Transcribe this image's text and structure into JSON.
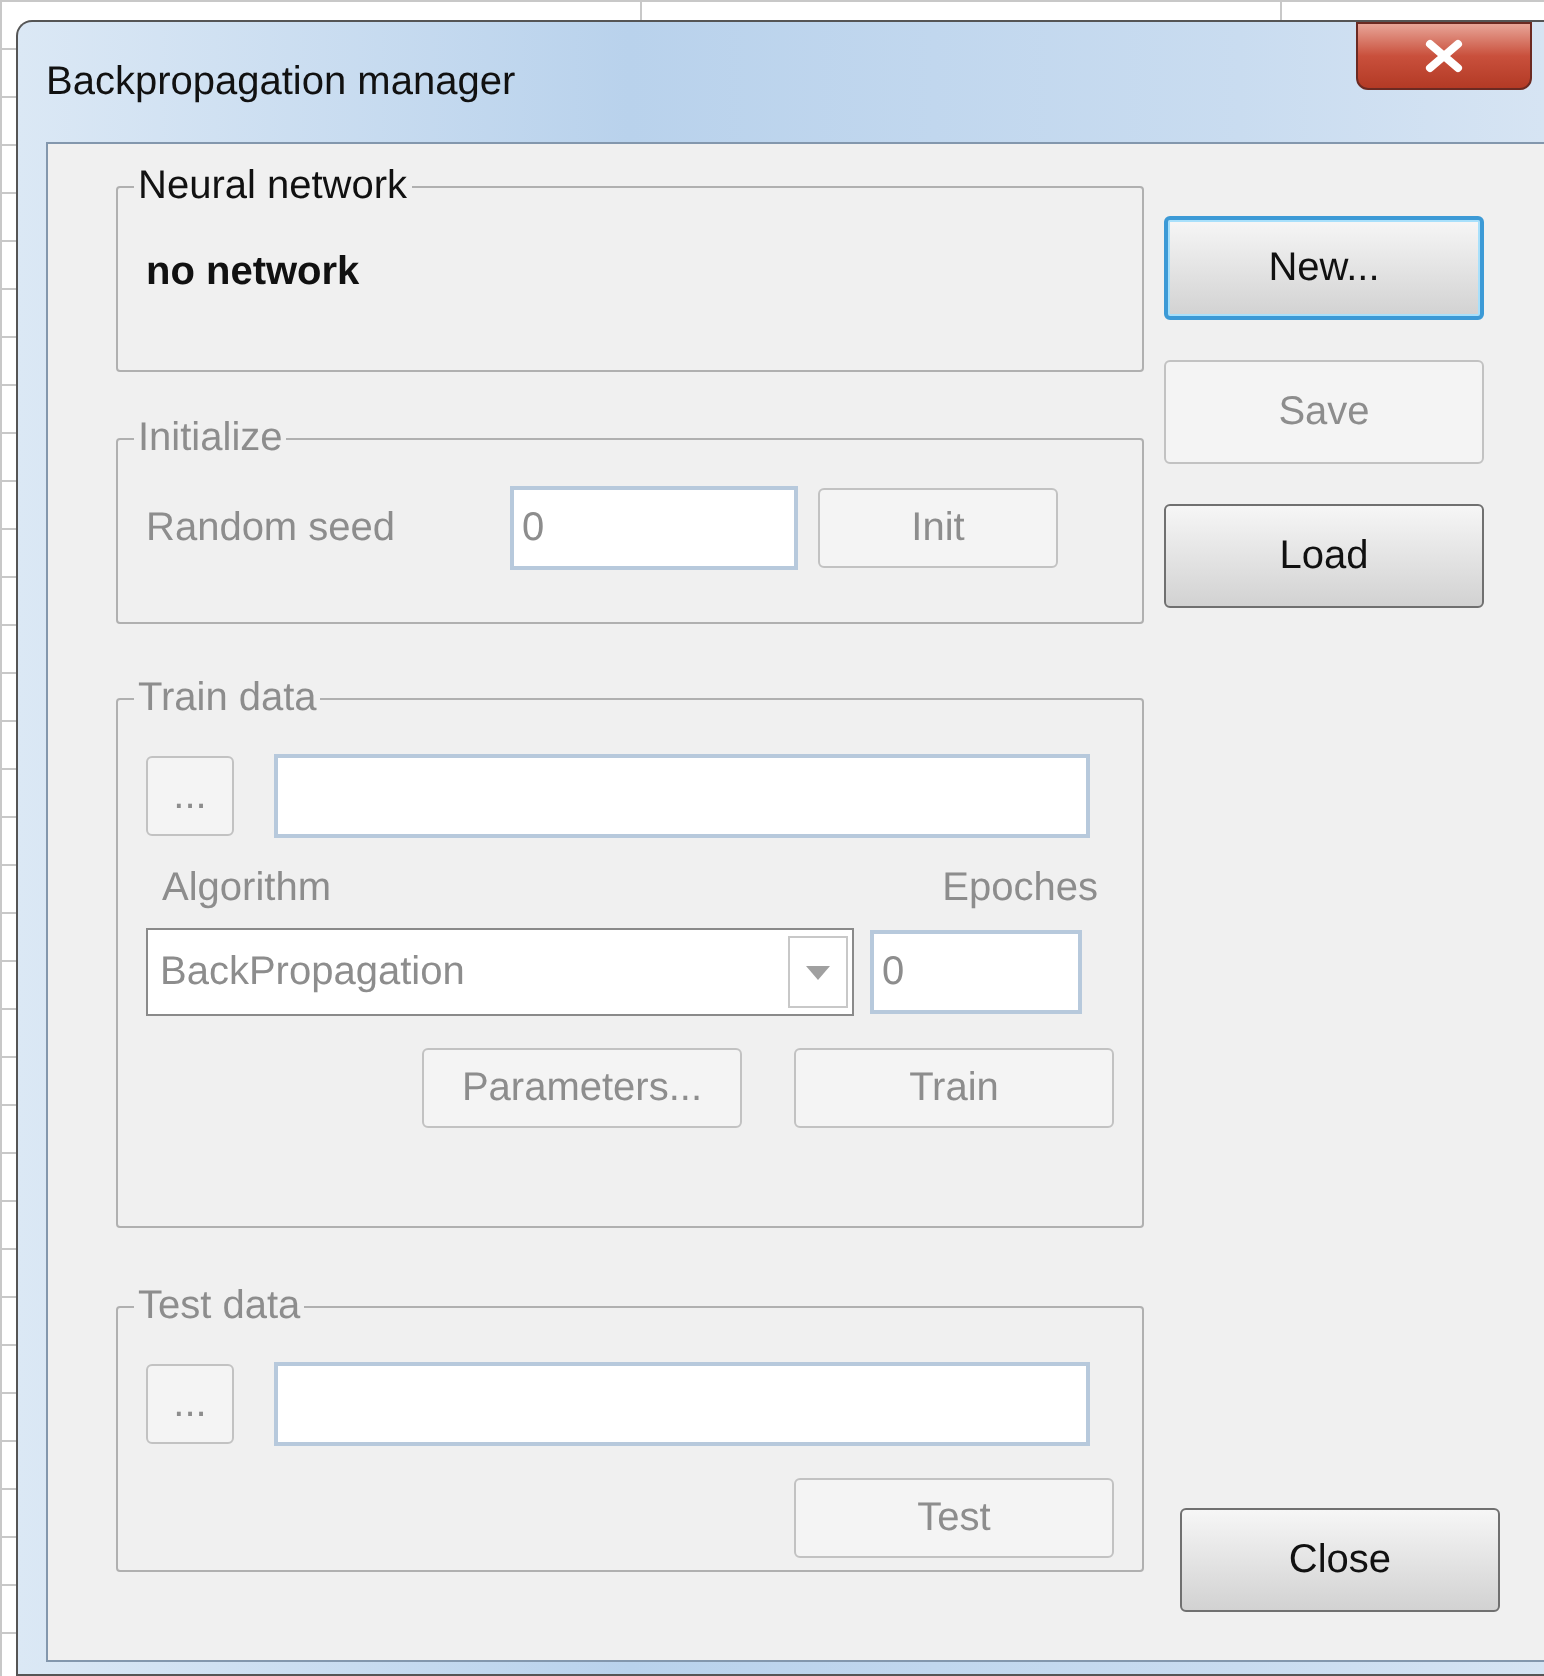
{
  "window": {
    "title": "Backpropagation manager"
  },
  "neural_network": {
    "title": "Neural network",
    "disabled": false,
    "status": "no network"
  },
  "initialize": {
    "title": "Initialize",
    "disabled": true,
    "seed_label": "Random seed",
    "seed_value": "0",
    "init_button": {
      "label": "Init",
      "disabled": true,
      "default": false
    }
  },
  "train_data": {
    "title": "Train data",
    "disabled": true,
    "browse_button": {
      "label": "...",
      "disabled": true,
      "default": false
    },
    "algorithm_label": "Algorithm",
    "algorithm_value": "BackPropagation",
    "epoches_label": "Epoches",
    "epoches_value": "0",
    "buttons": [
      {
        "label": "Parameters...",
        "disabled": true,
        "default": false
      },
      {
        "label": "Train",
        "disabled": true,
        "default": false
      }
    ]
  },
  "test_data": {
    "title": "Test data",
    "disabled": true,
    "browse_button": {
      "label": "...",
      "disabled": true,
      "default": false
    },
    "test_button": {
      "label": "Test",
      "disabled": true,
      "default": false
    }
  },
  "side_buttons": [
    {
      "label": "New...",
      "disabled": false,
      "default": true
    },
    {
      "label": "Save",
      "disabled": true,
      "default": false
    },
    {
      "label": "Load",
      "disabled": false,
      "default": false
    }
  ],
  "close_button": {
    "label": "Close",
    "disabled": false,
    "default": false
  }
}
